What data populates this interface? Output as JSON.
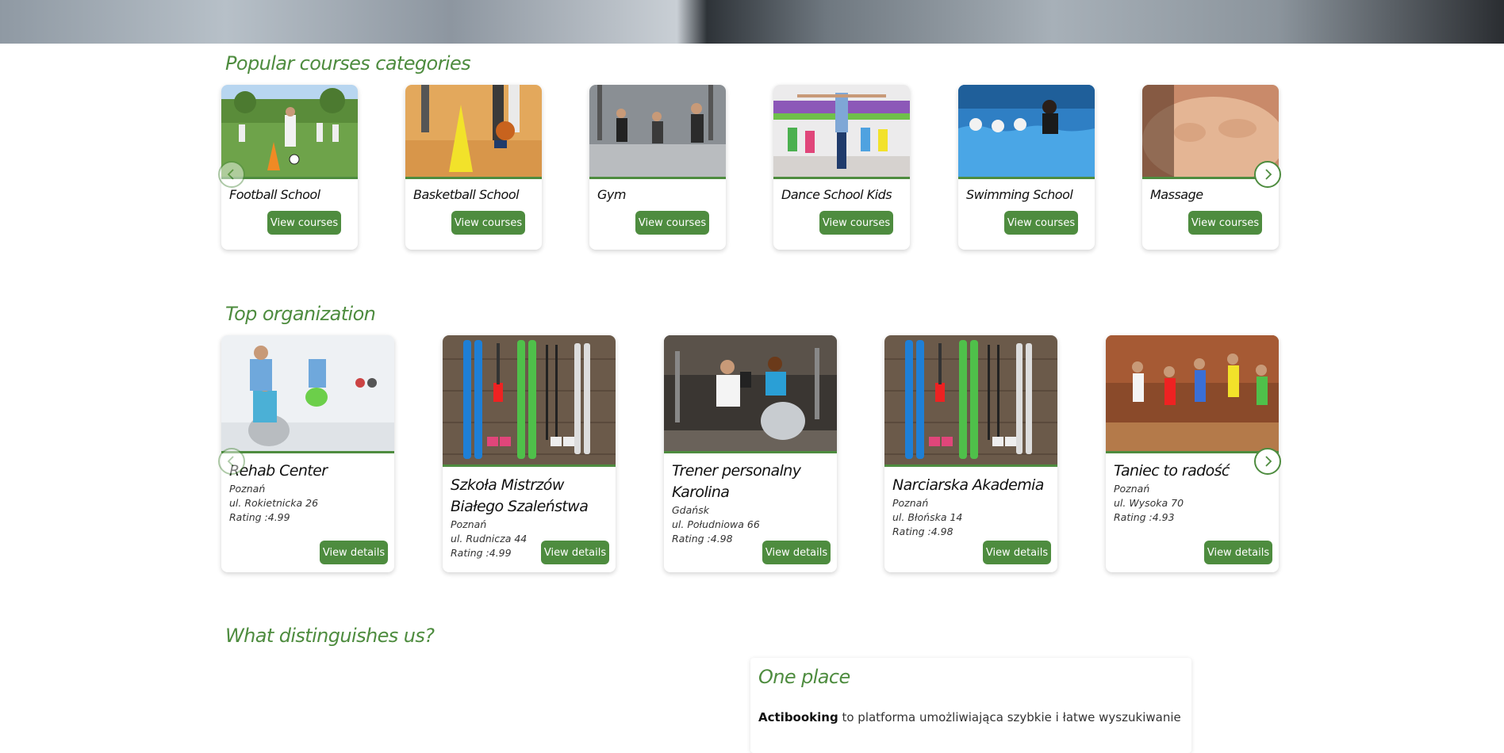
{
  "colors": {
    "accent": "#4e8c3f",
    "text": "#1a1a1a",
    "background": "#ffffff"
  },
  "sections": {
    "popular_title": "Popular courses categories",
    "top_org_title": "Top organization",
    "distinguish_title": "What distinguishes us?"
  },
  "categories": [
    {
      "name": "Football School",
      "button": "View courses",
      "image": "football-photo"
    },
    {
      "name": "Basketball School",
      "button": "View courses",
      "image": "basketball-photo"
    },
    {
      "name": "Gym",
      "button": "View courses",
      "image": "gym-photo"
    },
    {
      "name": "Dance School Kids",
      "button": "View courses",
      "image": "dance-kids-photo"
    },
    {
      "name": "Swimming School",
      "button": "View courses",
      "image": "swimming-photo"
    },
    {
      "name": "Massage",
      "button": "View courses",
      "image": "massage-photo"
    }
  ],
  "organizations": [
    {
      "name": "Rehab Center",
      "city": "Poznań",
      "street": "ul. Rokietnicka 26",
      "rating": "Rating :4.99",
      "button": "View details",
      "image": "rehab-photo"
    },
    {
      "name": "Szkoła Mistrzów Białego Szaleństwa",
      "city": "Poznań",
      "street": "ul. Rudnicza 44",
      "rating": "Rating :4.99",
      "button": "View details",
      "image": "skis-photo"
    },
    {
      "name": "Trener personalny Karolina",
      "city": "Gdańsk",
      "street": "ul. Południowa 66",
      "rating": "Rating :4.98",
      "button": "View details",
      "image": "trainer-photo"
    },
    {
      "name": "Narciarska Akademia",
      "city": "Poznań",
      "street": "ul. Błońska 14",
      "rating": "Rating :4.98",
      "button": "View details",
      "image": "skis-photo"
    },
    {
      "name": "Taniec to radość",
      "city": "Poznań",
      "street": "ul. Wysoka 70",
      "rating": "Rating :4.93",
      "button": "View details",
      "image": "dance-photo"
    }
  ],
  "feature": {
    "title": "One place",
    "brand": "Actibooking",
    "text": " to platforma umożliwiająca szybkie i łatwe wyszukiwanie"
  },
  "icons": {
    "prev": "chevron-left-icon",
    "next": "chevron-right-icon"
  }
}
